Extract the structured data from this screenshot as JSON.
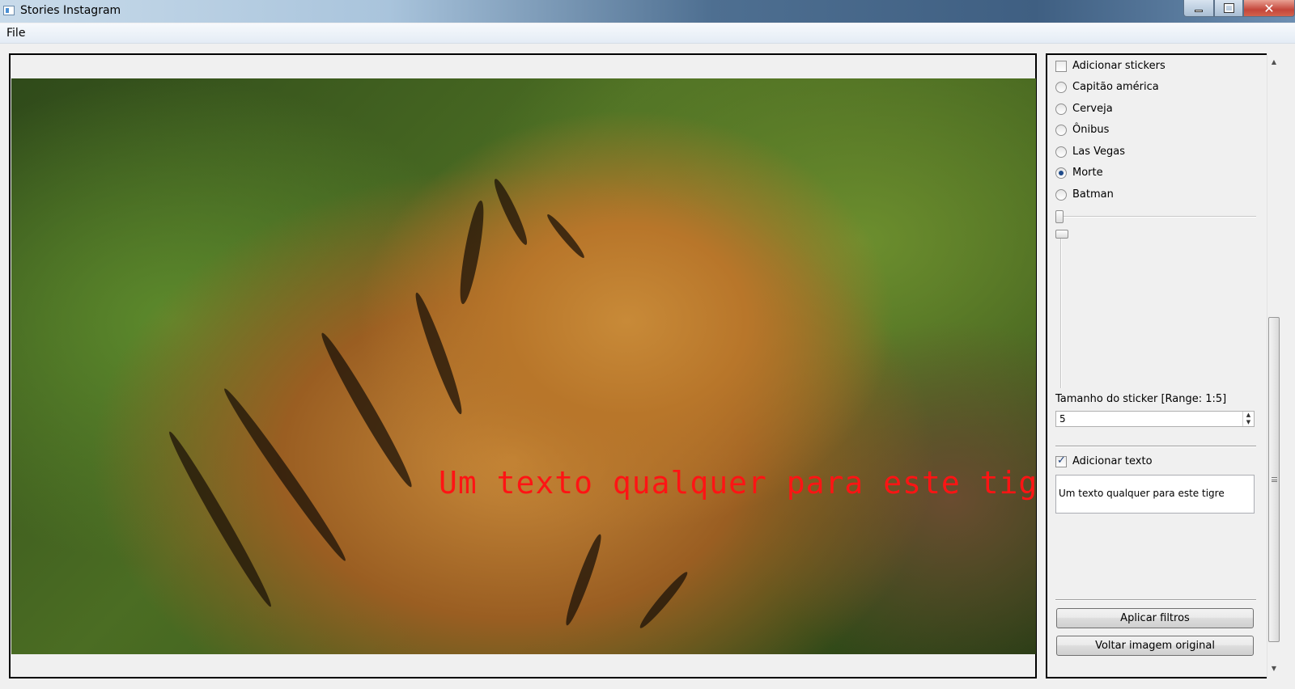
{
  "window": {
    "title": "Stories Instagram",
    "controls": {
      "minimize_icon": "minimize-icon",
      "maximize_icon": "maximize-icon",
      "close_label": "✕"
    }
  },
  "menubar": {
    "items": [
      {
        "label": "File"
      }
    ]
  },
  "image": {
    "description_icon": "image-canvas",
    "overlay_text": "Um texto qualquer para este tigre",
    "overlay_color": "#ff1414"
  },
  "sidebar": {
    "stickers_checkbox": {
      "label": "Adicionar stickers",
      "checked": false
    },
    "stickers": [
      {
        "label": "Capitão américa",
        "selected": false
      },
      {
        "label": "Cerveja",
        "selected": false
      },
      {
        "label": "Ônibus",
        "selected": false
      },
      {
        "label": "Las Vegas",
        "selected": false
      },
      {
        "label": "Morte",
        "selected": true
      },
      {
        "label": "Batman",
        "selected": false
      }
    ],
    "horizontal_slider": {
      "value": 0
    },
    "vertical_slider": {
      "value": 0
    },
    "size_label": "Tamanho do sticker [Range: 1:5]",
    "size_value": "5",
    "text_checkbox": {
      "label": "Adicionar texto",
      "checked": true
    },
    "text_value": "Um texto qualquer para este tigre",
    "apply_button": "Aplicar filtros",
    "reset_button": "Voltar imagem original"
  },
  "scrollbar": {
    "up_arrow": "▲",
    "down_arrow": "▼"
  }
}
